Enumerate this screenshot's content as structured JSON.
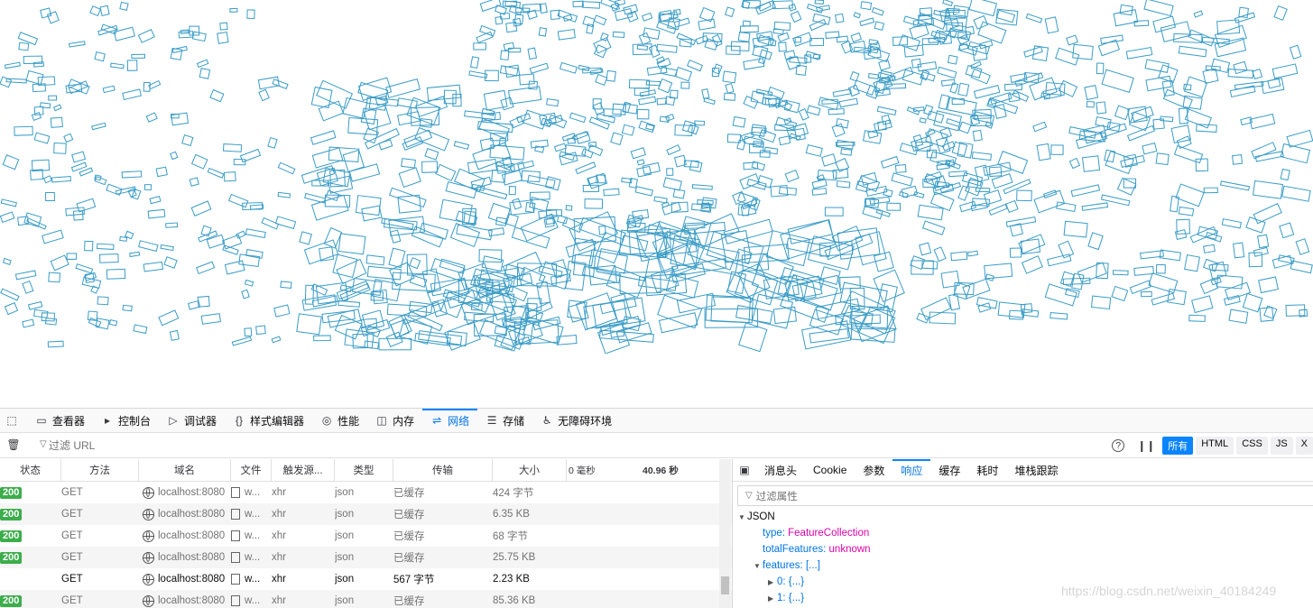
{
  "devtools": {
    "tabs": [
      {
        "label": "查看器",
        "icon": "inspector-icon"
      },
      {
        "label": "控制台",
        "icon": "console-icon"
      },
      {
        "label": "调试器",
        "icon": "debugger-icon"
      },
      {
        "label": "样式编辑器",
        "icon": "style-editor-icon"
      },
      {
        "label": "性能",
        "icon": "performance-icon"
      },
      {
        "label": "内存",
        "icon": "memory-icon"
      },
      {
        "label": "网络",
        "icon": "network-icon",
        "active": true
      },
      {
        "label": "存储",
        "icon": "storage-icon"
      },
      {
        "label": "无障碍环境",
        "icon": "accessibility-icon"
      }
    ],
    "filter": {
      "placeholder": "过滤 URL"
    },
    "type_filters": [
      "所有",
      "HTML",
      "CSS",
      "JS",
      "X"
    ],
    "active_type_filter": "所有",
    "columns": [
      "状态",
      "方法",
      "域名",
      "文件",
      "触发源...",
      "类型",
      "传输",
      "大小"
    ],
    "waterfall": {
      "start_label": "0 毫秒",
      "end_label": "40.96 秒"
    },
    "requests": [
      {
        "status": "200",
        "method": "GET",
        "domain": "localhost:8080",
        "file": "w...",
        "cause": "xhr",
        "type": "json",
        "transferred": "已缓存",
        "size": "424 字节"
      },
      {
        "status": "200",
        "method": "GET",
        "domain": "localhost:8080",
        "file": "w...",
        "cause": "xhr",
        "type": "json",
        "transferred": "已缓存",
        "size": "6.35 KB"
      },
      {
        "status": "200",
        "method": "GET",
        "domain": "localhost:8080",
        "file": "w...",
        "cause": "xhr",
        "type": "json",
        "transferred": "已缓存",
        "size": "68 字节"
      },
      {
        "status": "200",
        "method": "GET",
        "domain": "localhost:8080",
        "file": "w...",
        "cause": "xhr",
        "type": "json",
        "transferred": "已缓存",
        "size": "25.75 KB"
      },
      {
        "status": "",
        "method": "GET",
        "domain": "localhost:8080",
        "file": "w...",
        "cause": "xhr",
        "type": "json",
        "transferred": "567 字节",
        "size": "2.23 KB"
      },
      {
        "status": "200",
        "method": "GET",
        "domain": "localhost:8080",
        "file": "w...",
        "cause": "xhr",
        "type": "json",
        "transferred": "已缓存",
        "size": "85.36 KB"
      }
    ],
    "detail_tabs": [
      "消息头",
      "Cookie",
      "参数",
      "响应",
      "缓存",
      "耗时",
      "堆栈跟踪"
    ],
    "active_detail_tab": "响应",
    "prop_filter_placeholder": "过滤属性",
    "json_tree": {
      "root": "JSON",
      "type_key": "type:",
      "type_val": "FeatureCollection",
      "total_key": "totalFeatures:",
      "total_val": "unknown",
      "features_key": "features:",
      "features_val": "[...]",
      "item0_key": "0:",
      "item0_val": "{...}",
      "item1_key": "1:",
      "item1_val": "{...}"
    }
  },
  "watermark": "https://blog.csdn.net/weixin_40184249",
  "colors": {
    "building_stroke": "#3a9cc6",
    "accent": "#0a84ff",
    "status_ok": "#3cad4b"
  }
}
